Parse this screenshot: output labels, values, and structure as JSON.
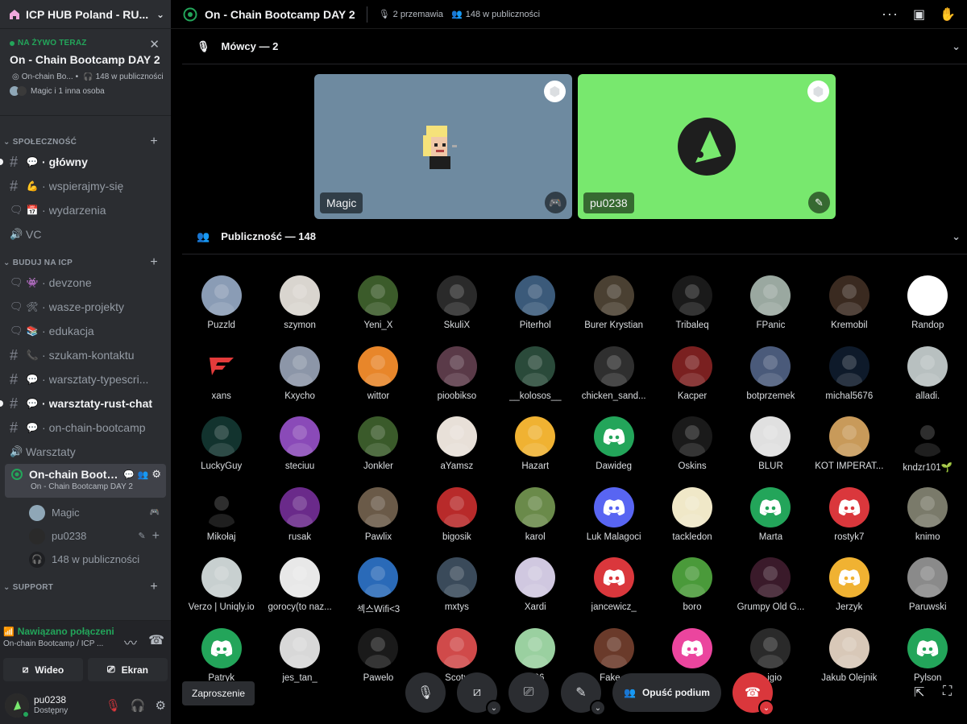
{
  "server": {
    "name": "ICP HUB Poland - RU..."
  },
  "live": {
    "tag": "NA ŻYWO TERAZ",
    "title": "On - Chain Bootcamp DAY 2",
    "channel": "On-chain Bo...",
    "listeners": "148 w publiczności",
    "people": "Magic i 1 inna osoba"
  },
  "categories": {
    "community": "SPOŁECZNOŚĆ",
    "build": "BUDUJ NA ICP",
    "support": "SUPPORT"
  },
  "channels": [
    {
      "emoji": "💬",
      "label": "główny",
      "type": "text",
      "unread": true
    },
    {
      "emoji": "💪",
      "label": "wspierajmy-się",
      "type": "text",
      "unread": false
    },
    {
      "emoji": "📅",
      "label": "wydarzenia",
      "type": "forum",
      "unread": false
    },
    {
      "emoji": "",
      "label": "VC",
      "type": "voice",
      "unread": false
    }
  ],
  "build_channels": [
    {
      "emoji": "👾",
      "label": "devzone",
      "type": "forum",
      "unread": false
    },
    {
      "emoji": "🛠",
      "label": "wasze-projekty",
      "type": "forum",
      "unread": false
    },
    {
      "emoji": "📚",
      "label": "edukacja",
      "type": "forum",
      "unread": false
    },
    {
      "emoji": "📞",
      "label": "szukam-kontaktu",
      "type": "text",
      "unread": false
    },
    {
      "emoji": "💬",
      "label": "warsztaty-typescri...",
      "type": "text",
      "unread": false
    },
    {
      "emoji": "💬",
      "label": "warsztaty-rust-chat",
      "type": "text",
      "unread": true
    },
    {
      "emoji": "💬",
      "label": "on-chain-bootcamp",
      "type": "text",
      "unread": false
    },
    {
      "emoji": "",
      "label": "Warsztaty",
      "type": "voice",
      "unread": false
    }
  ],
  "active_stage": {
    "label": "On-chain Bootc...",
    "topic": "On - Chain Bootcamp DAY 2",
    "members": [
      {
        "name": "Magic"
      },
      {
        "name": "pu0238"
      }
    ],
    "audience": "148 w publiczności"
  },
  "voice_panel": {
    "status": "Nawiązano połączeni",
    "location": "On-chain Bootcamp / ICP ...",
    "video": "Wideo",
    "screen": "Ekran"
  },
  "user": {
    "name": "pu0238",
    "status": "Dostępny"
  },
  "topbar": {
    "title": "On - Chain Bootcamp DAY 2",
    "speakers_count": "2 przemawia",
    "audience_count": "148 w publiczności"
  },
  "speakers": {
    "header": "Mówcy — 2",
    "tiles": [
      {
        "name": "Magic",
        "bg": "#6e8aa0"
      },
      {
        "name": "pu0238",
        "bg": "#78e86e"
      }
    ]
  },
  "audience": {
    "header": "Publiczność — 148",
    "members": [
      {
        "name": "Puzzld",
        "color": "#8a9cb5",
        "icon": "photo"
      },
      {
        "name": "szymon",
        "color": "#d9d5cf",
        "icon": "photo"
      },
      {
        "name": "Yeni_X",
        "color": "#3b5b2a",
        "icon": "photo"
      },
      {
        "name": "SkuliX",
        "color": "#2a2a2a",
        "icon": "photo"
      },
      {
        "name": "Piterhol",
        "color": "#3b5a7a",
        "icon": "photo"
      },
      {
        "name": "Burer Krystian",
        "color": "#4a4032",
        "icon": "photo"
      },
      {
        "name": "Tribaleq",
        "color": "#1a1a1a",
        "icon": "photo"
      },
      {
        "name": "FPanic",
        "color": "#9aa8a0",
        "icon": "photo"
      },
      {
        "name": "Kremobil",
        "color": "#3a2a20",
        "icon": "photo"
      },
      {
        "name": "Randop",
        "color": "#ffffff",
        "icon": "photo"
      },
      {
        "name": "xans",
        "color": "#000000",
        "icon": "faze"
      },
      {
        "name": "Kxycho",
        "color": "#8c96a8",
        "icon": "photo"
      },
      {
        "name": "wittor",
        "color": "#e8862a",
        "icon": "photo"
      },
      {
        "name": "pioobikso",
        "color": "#5a3a48",
        "icon": "photo"
      },
      {
        "name": "__kolosos__",
        "color": "#2a4a3a",
        "icon": "photo"
      },
      {
        "name": "chicken_sand...",
        "color": "#2f2f2f",
        "icon": "photo"
      },
      {
        "name": "Kacper",
        "color": "#7a2020",
        "icon": "photo"
      },
      {
        "name": "botprzemek",
        "color": "#4a5a7a",
        "icon": "photo"
      },
      {
        "name": "michal5676",
        "color": "#0e1a2a",
        "icon": "photo"
      },
      {
        "name": "alladi.",
        "color": "#b8c0c0",
        "icon": "photo"
      },
      {
        "name": "LuckyGuy",
        "color": "#12332e",
        "icon": "photo"
      },
      {
        "name": "steciuu",
        "color": "#8a4ab8",
        "icon": "photo"
      },
      {
        "name": "Jonkler",
        "color": "#3a5a2a",
        "icon": "photo"
      },
      {
        "name": "aYamsz",
        "color": "#e8e0d8",
        "icon": "photo"
      },
      {
        "name": "Hazart",
        "color": "#f0b232",
        "icon": "photo"
      },
      {
        "name": "Dawideg",
        "color": "#23a55a",
        "icon": "discord"
      },
      {
        "name": "Oskins",
        "color": "#1a1a1a",
        "icon": "photo"
      },
      {
        "name": "BLUR",
        "color": "#e0e0e0",
        "icon": "photo"
      },
      {
        "name": "KOT IMPERAT...",
        "color": "#c89a5a",
        "icon": "photo"
      },
      {
        "name": "kndzr101🌱",
        "color": "#000000",
        "icon": "photo"
      },
      {
        "name": "Mikołaj",
        "color": "#000000",
        "icon": "photo"
      },
      {
        "name": "rusak",
        "color": "#6a2a8a",
        "icon": "photo"
      },
      {
        "name": "Pawlix",
        "color": "#6a5a48",
        "icon": "photo"
      },
      {
        "name": "bigosik",
        "color": "#b82a2a",
        "icon": "photo"
      },
      {
        "name": "karol",
        "color": "#6a8a4a",
        "icon": "photo"
      },
      {
        "name": "Luk Malagoci",
        "color": "#5865f2",
        "icon": "discord"
      },
      {
        "name": "tackledon",
        "color": "#f0e8c8",
        "icon": "photo"
      },
      {
        "name": "Marta",
        "color": "#23a55a",
        "icon": "discord"
      },
      {
        "name": "rostyk7",
        "color": "#da373c",
        "icon": "discord"
      },
      {
        "name": "knimo",
        "color": "#7a7a6a",
        "icon": "photo"
      },
      {
        "name": "Verzo | Uniqly.io",
        "color": "#c8d0d0",
        "icon": "photo"
      },
      {
        "name": "gorocy(to naz...",
        "color": "#e8e8e8",
        "icon": "photo"
      },
      {
        "name": "섹스Wifi<3",
        "color": "#2a6ab8",
        "icon": "photo"
      },
      {
        "name": "mxtys",
        "color": "#3a4a5a",
        "icon": "photo"
      },
      {
        "name": "Xardi",
        "color": "#d0c8e0",
        "icon": "photo"
      },
      {
        "name": "jancewicz_",
        "color": "#da373c",
        "icon": "discord"
      },
      {
        "name": "boro",
        "color": "#4a9a3a",
        "icon": "photo"
      },
      {
        "name": "Grumpy Old G...",
        "color": "#3a1a2a",
        "icon": "photo"
      },
      {
        "name": "Jerzyk",
        "color": "#f0b232",
        "icon": "discord"
      },
      {
        "name": "Paruwski",
        "color": "#8a8a8a",
        "icon": "photo"
      },
      {
        "name": "Patryk",
        "color": "#23a55a",
        "icon": "discord"
      },
      {
        "name": "jes_tan_",
        "color": "#d8d8d8",
        "icon": "photo"
      },
      {
        "name": "Pawelo",
        "color": "#1a1a1a",
        "icon": "photo"
      },
      {
        "name": "Scotu",
        "color": "#d04a4a",
        "icon": "photo"
      },
      {
        "name": "...26",
        "color": "#9ad0a0",
        "icon": "photo"
      },
      {
        "name": "Fake...",
        "color": "#6a3a2a",
        "icon": "photo"
      },
      {
        "name": "",
        "color": "#eb459e",
        "icon": "discord"
      },
      {
        "name": "...igio",
        "color": "#2a2a2a",
        "icon": "photo"
      },
      {
        "name": "Jakub Olejnik",
        "color": "#d8c8b8",
        "icon": "photo"
      },
      {
        "name": "Pylson",
        "color": "#23a55a",
        "icon": "discord"
      }
    ]
  },
  "controls": {
    "invite": "Zaproszenie",
    "leave": "Opuść podium"
  }
}
